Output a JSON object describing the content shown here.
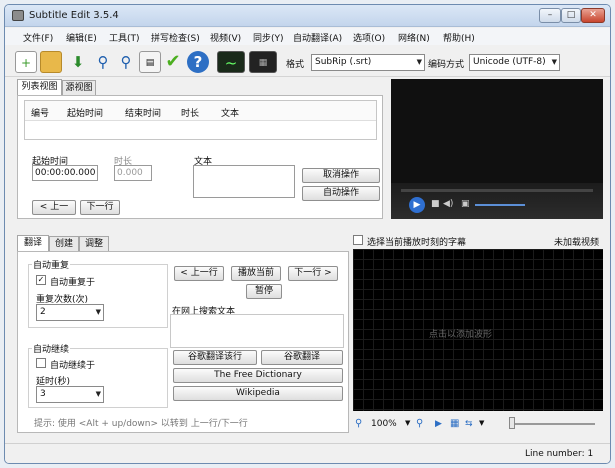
{
  "window": {
    "title": "Subtitle Edit 3.5.4",
    "min": "–",
    "max": "□",
    "close": "✕"
  },
  "menu": [
    "文件(F)",
    "编辑(E)",
    "工具(T)",
    "拼写检查(S)",
    "视频(V)",
    "同步(Y)",
    "自动翻译(A)",
    "选项(O)",
    "网络(N)",
    "帮助(H)"
  ],
  "toolbar": {
    "format_label": "格式",
    "format_value": "SubRip (.srt)",
    "encoding_label": "编码方式",
    "encoding_value": "Unicode (UTF-8)"
  },
  "list": {
    "tabs": [
      "列表视图",
      "源视图"
    ],
    "columns": [
      "编号",
      "起始时间",
      "结束时间",
      "时长",
      "文本"
    ]
  },
  "editor": {
    "start_label": "起始时间",
    "start_value": "00:00:00.000",
    "duration_label": "时长",
    "duration_value": "0.000",
    "text_label": "文本",
    "undo": "取消操作",
    "auto": "自动操作",
    "prev": "< 上一",
    "next": "下一行"
  },
  "bottom_tabs": [
    "翻译",
    "创建",
    "调整"
  ],
  "translate": {
    "auto_repeat_title": "自动重复",
    "auto_repeat_on": "自动重复于",
    "repeat_count_label": "重复次数(次)",
    "repeat_count_value": "2",
    "auto_continue_title": "自动继续",
    "auto_continue_on": "自动继续于",
    "delay_label": "延时(秒)",
    "delay_value": "3",
    "prev_line": "< 上一行",
    "play_current": "播放当前",
    "next_line": "下一行 >",
    "pause": "暂停",
    "search_web": "在网上搜索文本",
    "google_translate_it": "谷歌翻译该行",
    "google_translate": "谷歌翻译",
    "free_dictionary": "The Free Dictionary",
    "wikipedia": "Wikipedia",
    "hint": "提示: 使用 <Alt + up/down> 以转到 上一行/下一行"
  },
  "waveform": {
    "select_current": "选择当前播放时刻的字幕",
    "no_video": "未加载视频",
    "click_to_add": "点击以添加波形",
    "zoom": "100%"
  },
  "status": {
    "line_number": "Line number: 1"
  }
}
